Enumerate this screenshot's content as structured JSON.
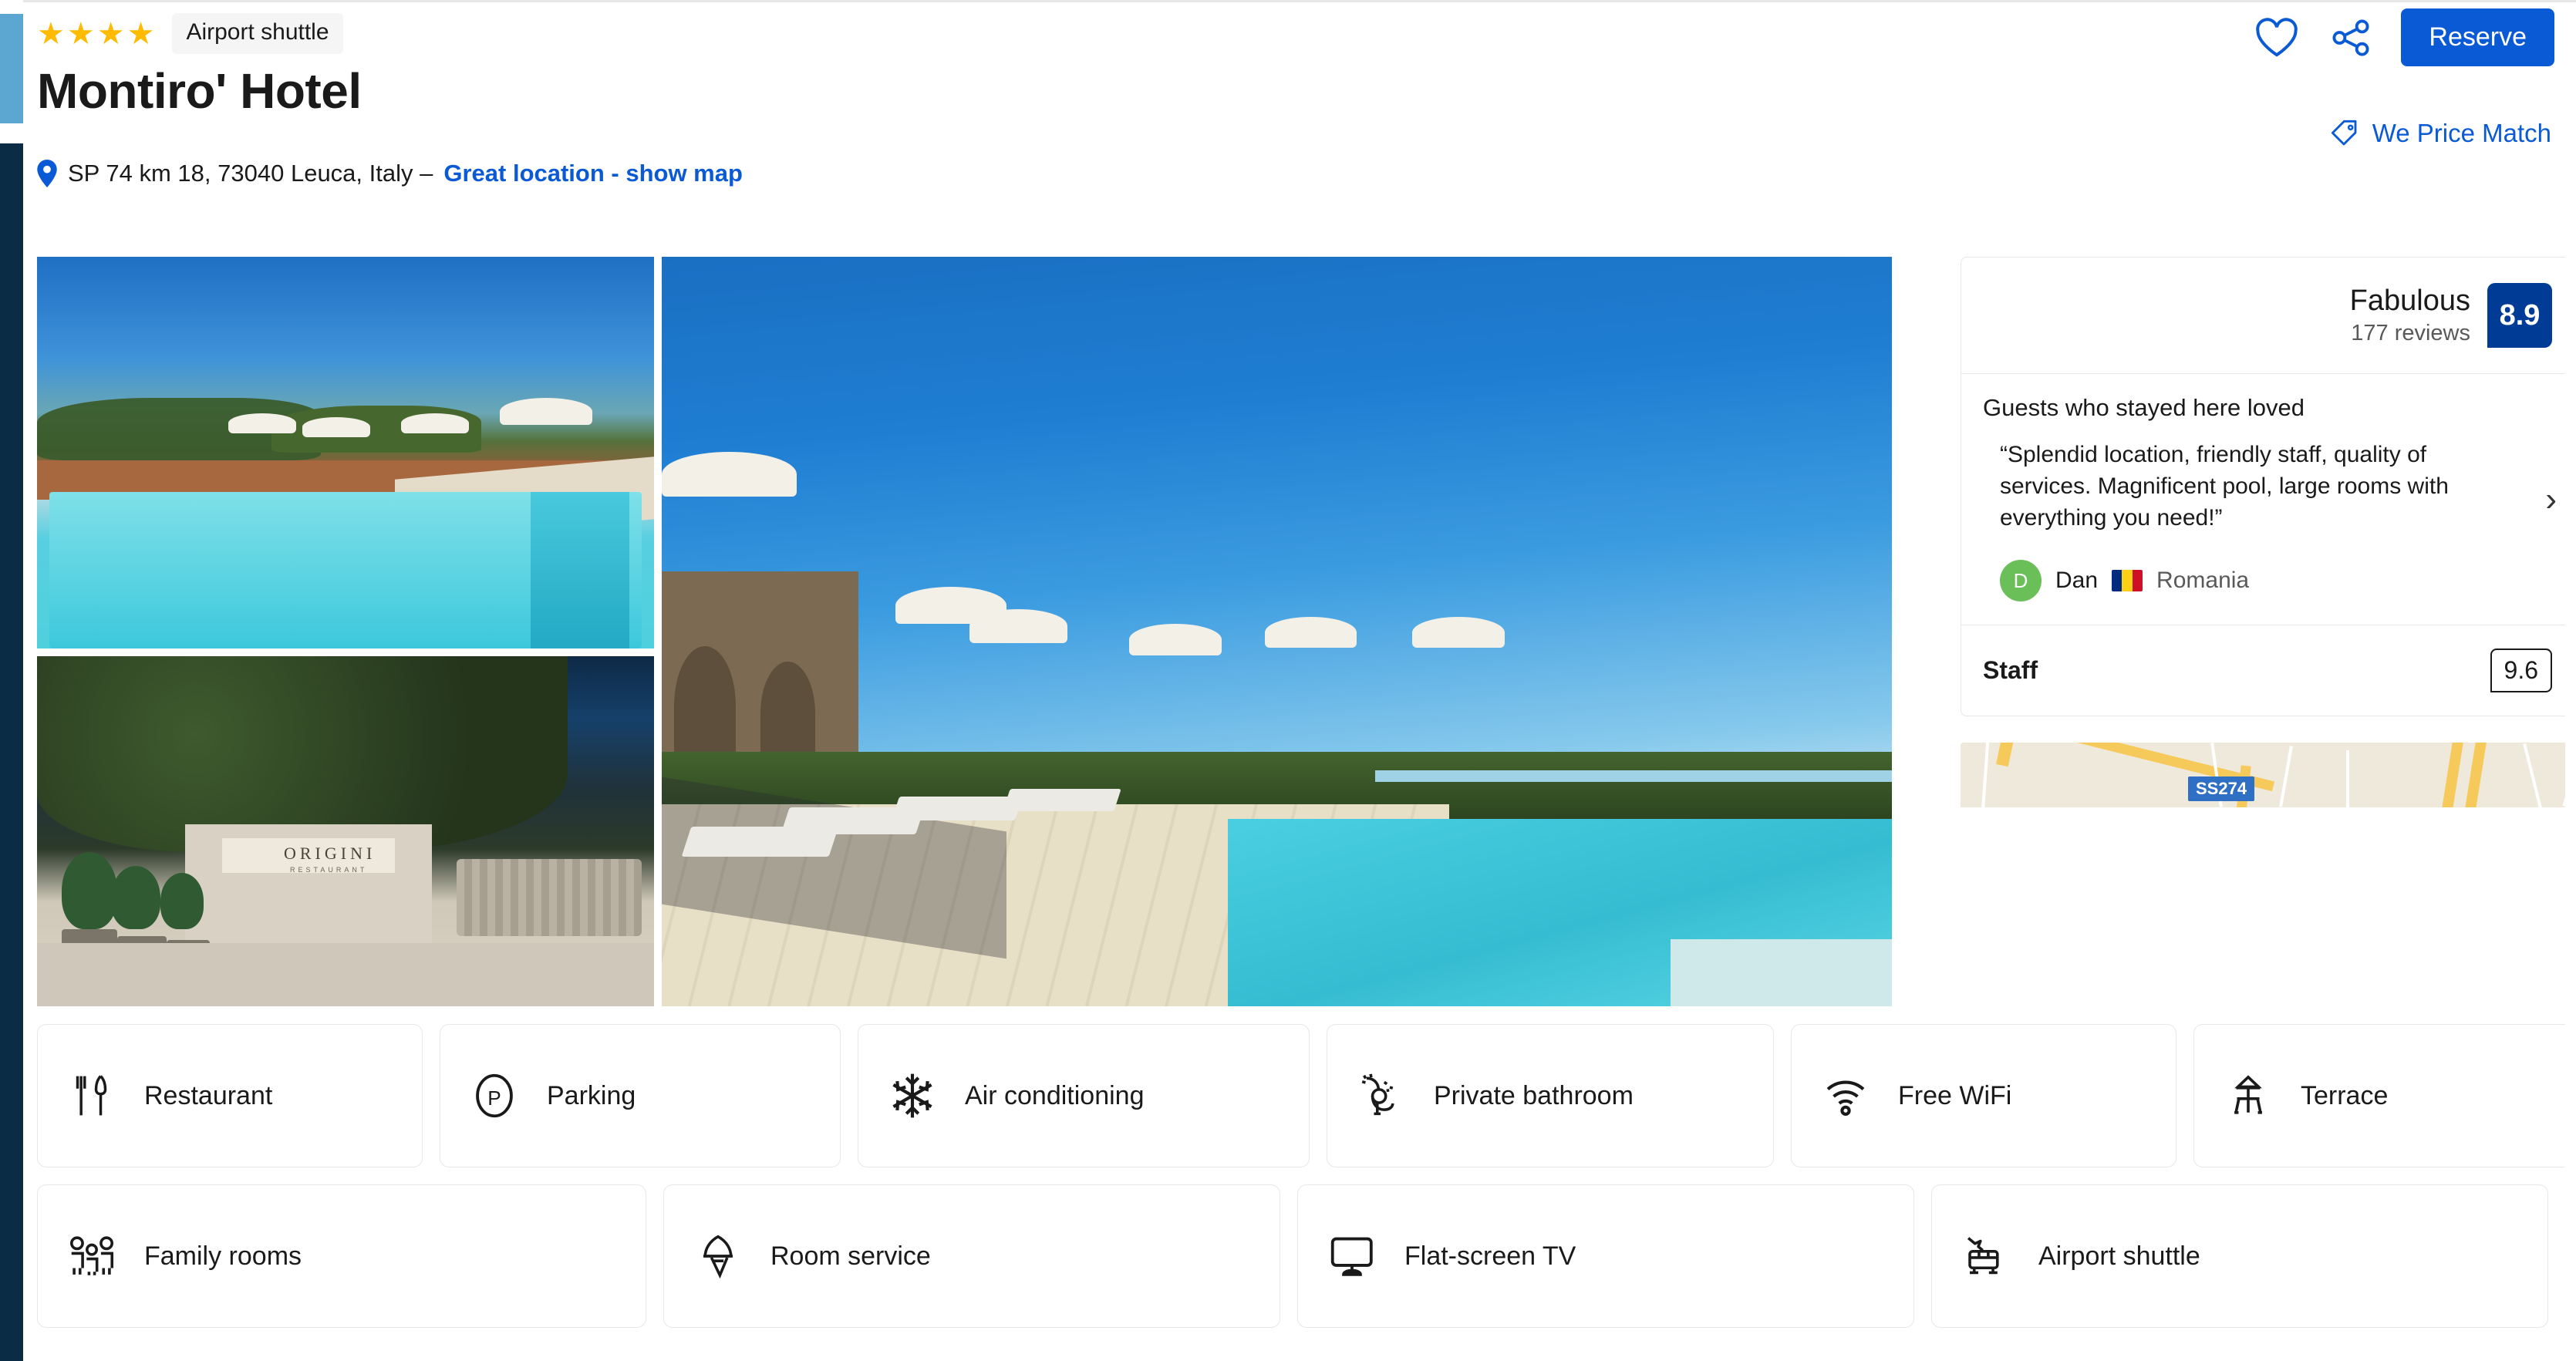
{
  "header": {
    "star_count": 4,
    "star_glyph": "★",
    "badge_label": "Airport shuttle",
    "hotel_name": "Montiro' Hotel",
    "address": "SP 74 km 18, 73040 Leuca, Italy –",
    "map_link": "Great location - show map",
    "favorite_icon": "heart-icon",
    "share_icon": "share-icon",
    "reserve_label": "Reserve",
    "price_match_label": "We Price Match",
    "price_match_icon": "tag-icon",
    "accent_blue": "#0a5ad6",
    "star_gold": "#febb02"
  },
  "gallery": {
    "thumb_1_alt": "Outdoor swimming pool with sun loungers and parasols",
    "thumb_2_alt": "ORIGINI restaurant entrance with cacti and garden",
    "hero_alt": "Large turquoise pool with paved terrace and white parasols",
    "restaurant_sign": "ORIGINI",
    "restaurant_sign_sub": "RESTAURANT"
  },
  "review_card": {
    "score_label": "Fabulous",
    "review_count": "177 reviews",
    "score": "8.9",
    "score_badge_color": "#003b95",
    "loved_title": "Guests who stayed here loved",
    "quote": "“Splendid location, friendly staff, quality of services. Magnificent pool, large rooms with everything you need!”",
    "reviewer_initial": "D",
    "reviewer_name": "Dan",
    "reviewer_country": "Romania",
    "avatar_color": "#6bbf59",
    "next_icon": "chevron-right-icon",
    "subscore_label": "Staff",
    "subscore_value": "9.6"
  },
  "map_preview": {
    "road_shield": "SS274",
    "background_color": "#efe9dc",
    "road_color": "#f6c95b",
    "shield_color": "#2f6fc4"
  },
  "amenities": {
    "row1": [
      {
        "label": "Restaurant",
        "icon": "cutlery-icon"
      },
      {
        "label": "Parking",
        "icon": "parking-icon"
      },
      {
        "label": "Air conditioning",
        "icon": "snowflake-icon"
      },
      {
        "label": "Private bathroom",
        "icon": "shower-icon"
      },
      {
        "label": "Free WiFi",
        "icon": "wifi-icon"
      },
      {
        "label": "Terrace",
        "icon": "terrace-icon"
      }
    ],
    "row2": [
      {
        "label": "Family rooms",
        "icon": "family-icon"
      },
      {
        "label": "Room service",
        "icon": "room-service-icon"
      },
      {
        "label": "Flat-screen TV",
        "icon": "tv-icon"
      },
      {
        "label": "Airport shuttle",
        "icon": "shuttle-icon"
      }
    ]
  }
}
